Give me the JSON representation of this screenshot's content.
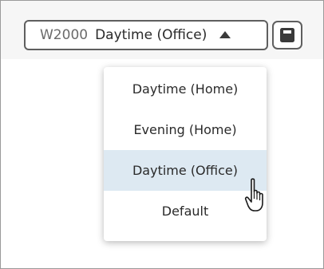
{
  "profile_select": {
    "model": "W2000",
    "value": "Daytime (Office)"
  },
  "save_button": {
    "icon": "floppy-disk-icon"
  },
  "dropdown": {
    "items": [
      {
        "label": "Daytime (Home)",
        "selected": false
      },
      {
        "label": "Evening (Home)",
        "selected": false
      },
      {
        "label": "Daytime (Office)",
        "selected": true
      },
      {
        "label": "Default",
        "selected": false
      }
    ]
  },
  "cursor": {
    "icon": "hand-pointer-icon"
  },
  "colors": {
    "selected_highlight": "#dde9f2",
    "border": "#5f5f5f",
    "header_background": "#f6f6f6"
  }
}
